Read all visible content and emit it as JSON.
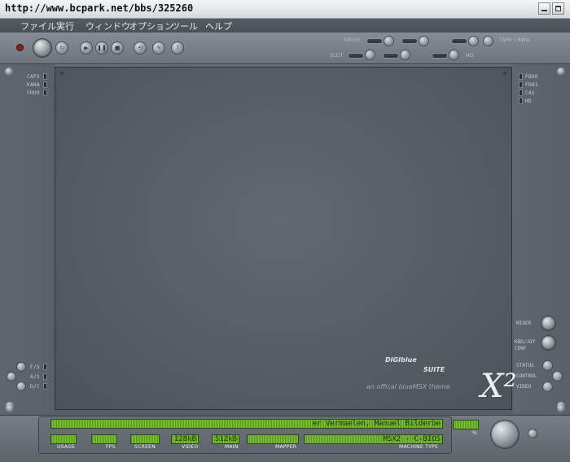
{
  "titlebar": {
    "title": "http://www.bcpark.net/bbs/325260"
  },
  "menu": {
    "items": [
      "ファイル",
      "実行",
      "ウィンドウ",
      "オプション",
      "ツール",
      "ヘルプ"
    ]
  },
  "toolbar": {
    "labels": {
      "drive": "DRIVE",
      "slot": "SLOT",
      "tape": "TAPE / RWD",
      "hd": "HD"
    },
    "transport_icons": [
      "play-icon",
      "pause-icon",
      "stop-icon"
    ],
    "tool_icons": [
      "reset-icon",
      "wrench-icon",
      "help-icon"
    ]
  },
  "left_panel": {
    "indicators": [
      "CAPS",
      "KANA",
      "FDD0"
    ],
    "bottom_indicators": [
      "F/S",
      "A/S",
      "D/C"
    ]
  },
  "right_panel": {
    "indicators": [
      "FDD0",
      "FDD1",
      "CAS",
      "HD"
    ],
    "controls": [
      "MIXER",
      "KBD/JOY CONF",
      "STATUS",
      "CONTROL",
      "VIDEO"
    ]
  },
  "display": {
    "brand_line1": "DIGIblue",
    "brand_line2": "SUITE",
    "brand_tagline": "an offical blueMSX theme",
    "brand_mark": "X²"
  },
  "status": {
    "marquee": "er Vermaelen, Manuel Bilderbe",
    "usage": {
      "label": "USAGE",
      "value": ""
    },
    "fps": {
      "label": "FPS",
      "value": ""
    },
    "screen": {
      "label": "SCREEN",
      "value": ""
    },
    "video": {
      "label": "VIDEO",
      "value": "128kB"
    },
    "main": {
      "label": "MAIN",
      "value": "512kB"
    },
    "mapper": {
      "label": "MAPPER",
      "value": ""
    },
    "machine": {
      "label": "MACHINE TYPE",
      "value": "MSX2 - C-BIOS"
    },
    "volume_label": "%"
  }
}
